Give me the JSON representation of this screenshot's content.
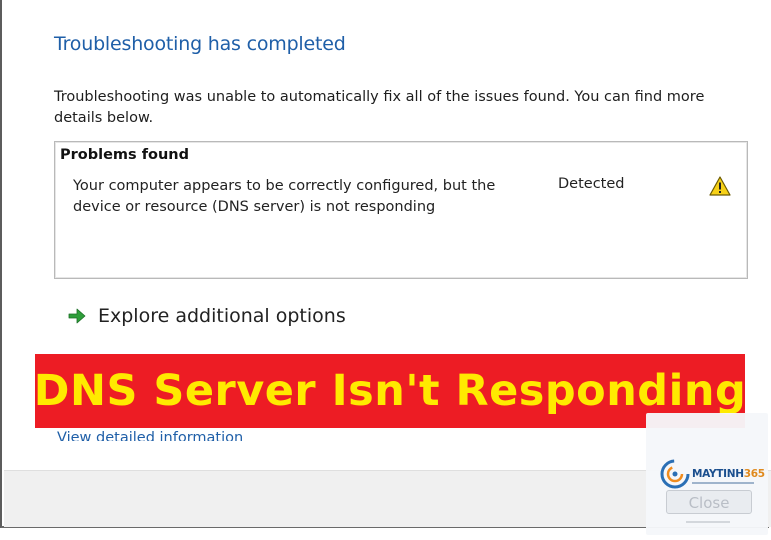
{
  "dialog": {
    "title": "Troubleshooting has completed",
    "description": "Troubleshooting was unable to automatically fix all of the issues found. You can find more details below."
  },
  "problems": {
    "header": "Problems found",
    "items": [
      {
        "text": "Your computer appears to be correctly configured, but the device or resource (DNS server) is not responding",
        "status": "Detected",
        "icon": "warning-icon"
      }
    ]
  },
  "explore": {
    "label": "Explore additional options",
    "icon": "green-arrow-icon"
  },
  "banner": {
    "text": "DNS Server Isn't Responding",
    "background": "#ed1c24",
    "color": "#ffea00"
  },
  "detail_link": {
    "label": "View detailed information"
  },
  "watermark": {
    "brand_main": "MAYTINH",
    "brand_num": "365"
  },
  "footer": {
    "close_label": "Close"
  },
  "colors": {
    "title_blue": "#1f5fa8",
    "footer_bg": "#f0f0f0"
  }
}
